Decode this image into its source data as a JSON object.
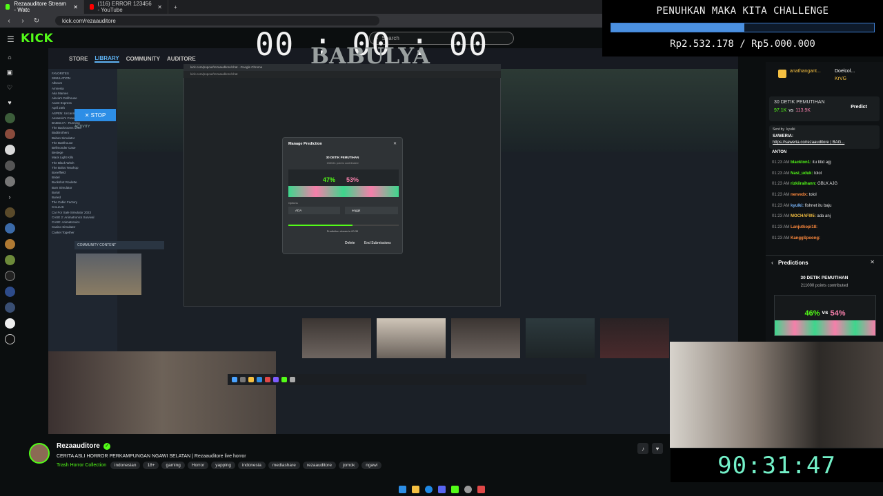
{
  "tabs": [
    {
      "label": "Rezaauditore Stream - Watc",
      "color": "#53fc18"
    },
    {
      "label": "(116) ERROR 123456 - YouTube",
      "color": "#ff0000"
    }
  ],
  "address": {
    "url": "kick.com/rezaauditore"
  },
  "kick": {
    "logo": "KICK",
    "search_placeholder": "Search"
  },
  "steam": {
    "nav": {
      "store": "STORE",
      "library": "LIBRARY",
      "community": "COMMUNITY",
      "auditore": "AUDITORE"
    },
    "timer": "00 : 00 : 00",
    "game_title": "BABULYA",
    "stop_label": "STOP",
    "community_content": "COMMUNITY CONTENT",
    "activity": "ACTIVITY",
    "side_list": [
      "FAVORITES",
      "SIMULATION",
      "Albeum",
      "Amnesia",
      "Aka Mames",
      "Alexia's Dollhouse",
      "Avant Express",
      "April 24th",
      "ASPEN: Uncanny Home",
      "Assassin's Creed Unity",
      "BABULYA - Running",
      "The Backrooms 1998",
      "BadBrothers",
      "Bahan Simulator",
      "The Bathhouse",
      "Bellmonder Case",
      "Bestege",
      "Mack Light Kills",
      "The Black Witch",
      "The Bolos Teashop",
      "Boneffield",
      "Bridel",
      "Buckshot Roulette",
      "Bum Simulator",
      "Burial",
      "Buried",
      "The Cabin Factory",
      "CALLUS",
      "Car For Sale Simulator 2023",
      "CASE 2: Animatronics Survival",
      "CASE: Animatronics",
      "Casino Simulator",
      "Casket Together"
    ]
  },
  "popup": {
    "title": "kick.com/popout/rezaauditore/chat - Google Chrome",
    "url": "kick.com/popout/rezaauditore/chat"
  },
  "modal": {
    "title": "Manage Prediction",
    "question": "30 DETIK PEMUTIHAN",
    "sub": "153541 points contributed",
    "pct_left": "47%",
    "pct_right": "53%",
    "options_label": "Options",
    "opt_a": "ADA",
    "opt_b": "enggk",
    "closes": "Prediction closes in 00:39",
    "delete": "Delete",
    "end": "End Submissions"
  },
  "challenge": {
    "title": "PENUHKAN MAKA KITA CHALLENGE",
    "amount": "Rp2.532.178 / Rp5.000.000",
    "progress": 0.506
  },
  "chat": {
    "top_user1": "anathangant...",
    "top_user2": "Doelcol...",
    "top_user3": "KrVG",
    "pred_title": "30 DETIK PEMUTIHAN",
    "pred_a": "97.1K",
    "pred_vs": "vs",
    "pred_b": "113.9K",
    "predict_btn": "Predict",
    "sent_by": "Sent by",
    "sent_user": "kyulki",
    "saweria_label": "SAWERIA:",
    "saweria_link": "https://saweria.co/rezaauditore | BAG...",
    "lines": [
      {
        "time": "01:23 AM",
        "user": "blackton1:",
        "msg": "itu titid ajg"
      },
      {
        "time": "01:23 AM",
        "user": "Nasi_uduk:",
        "msg": "tolol"
      },
      {
        "time": "01:23 AM",
        "user": "rizkiiraihann:",
        "msg": "GBLK AJG"
      },
      {
        "time": "01:23 AM",
        "user": "nervedx:",
        "msg": "tolol"
      },
      {
        "time": "01:23 AM",
        "user": "kyulki:",
        "msg": "fishnet itu baju"
      },
      {
        "time": "01:23 AM",
        "user": "MOCHAFI05:",
        "msg": "ada anj"
      },
      {
        "time": "01:23 AM",
        "user": "Lanjutkopi18:",
        "msg": ""
      },
      {
        "time": "01:23 AM",
        "user": "KanggSpoong:",
        "msg": ""
      }
    ],
    "anton": "ANTON"
  },
  "predictions_panel": {
    "header": "Predictions",
    "question": "30 DETIK PEMUTIHAN",
    "points": "211000 points contributed",
    "pct_left": "46%",
    "pct_vs": "vs",
    "pct_right": "54%"
  },
  "countdown": "90:31:47",
  "channel": {
    "name": "Rezaauditore",
    "title": "CERITA ASLI HORROR PERKAMPUNGAN NGAWI SELATAN | Rezaauditore live horror",
    "category": "Trash Horror Collection",
    "tags": [
      "indonesian",
      "18+",
      "gaming",
      "Horror",
      "yapping",
      "indonesia",
      "mediashare",
      "rezaauditore",
      "jomok",
      "ngawi"
    ]
  },
  "colors": {
    "kick_green": "#53fc18",
    "steam_blue": "#2d8ee6",
    "bar_blue": "#4b90e0"
  }
}
